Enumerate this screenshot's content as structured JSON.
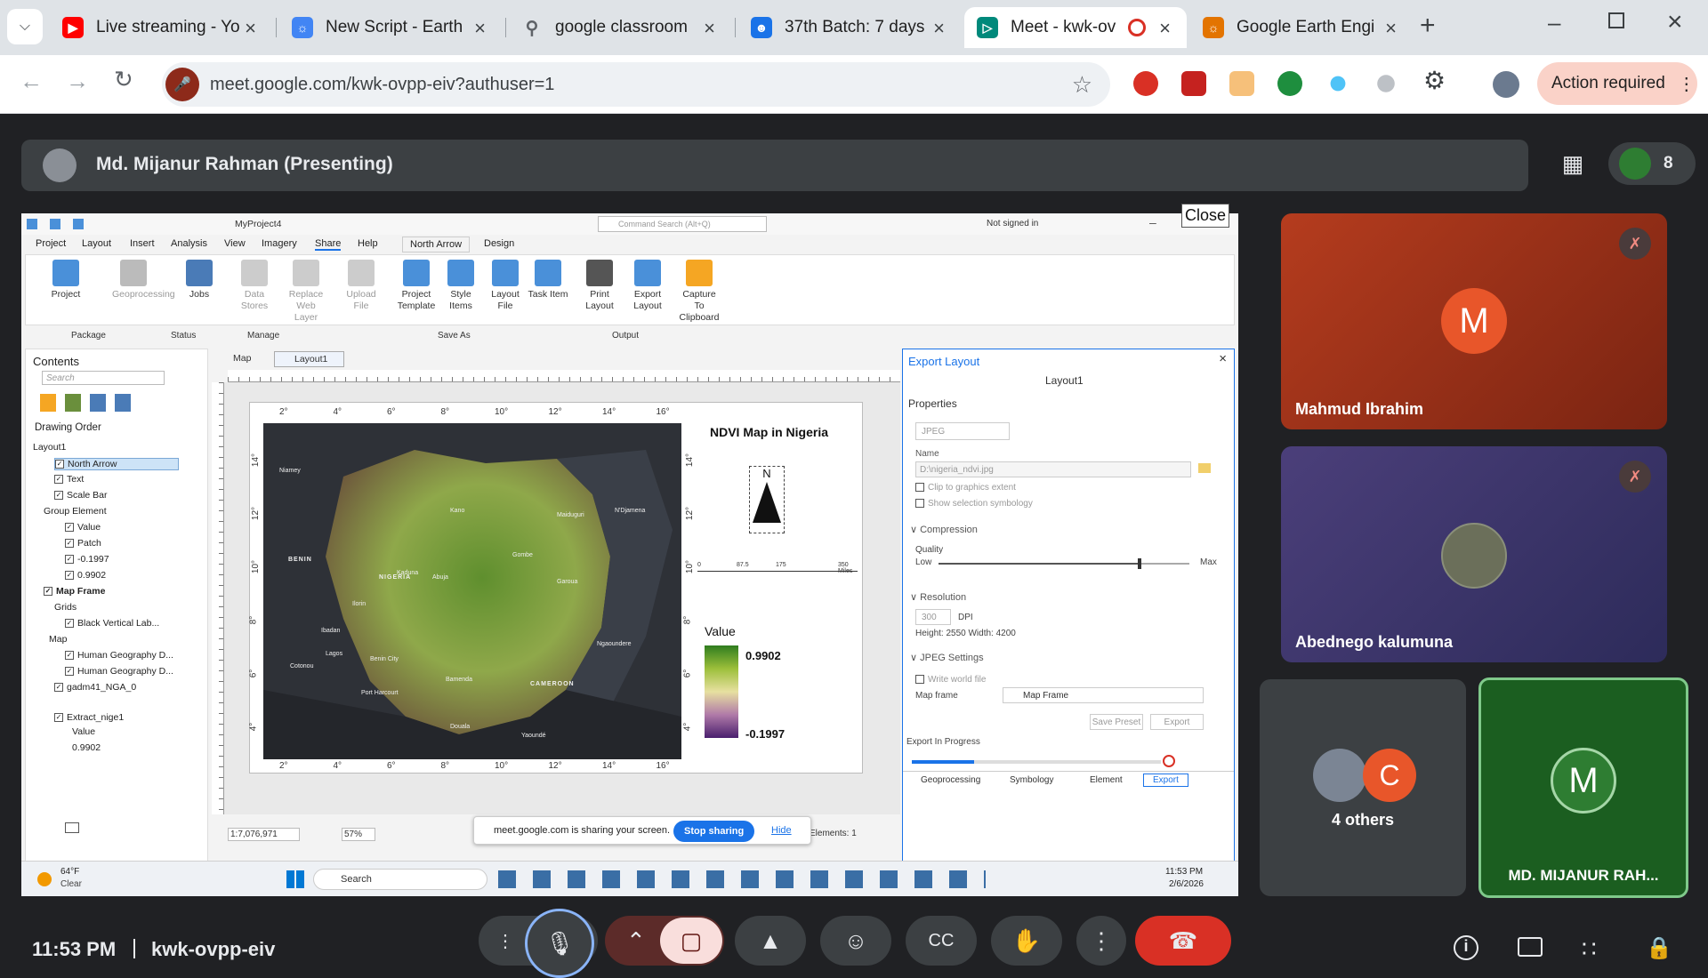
{
  "browser": {
    "tabs": [
      {
        "title": "Live streaming - Yo",
        "icon": "youtube-icon",
        "color": "#ff0000"
      },
      {
        "title": "New Script - Earth",
        "icon": "earth-engine-icon",
        "color": "#1a73e8"
      },
      {
        "title": "google classroom",
        "icon": "search-icon",
        "color": "#5f6368"
      },
      {
        "title": "37th Batch: 7 days",
        "icon": "classroom-icon",
        "color": "#1a73e8"
      },
      {
        "title": "Meet - kwk-ov",
        "icon": "meet-icon",
        "color": "#00897b"
      },
      {
        "title": "Google Earth Engi",
        "icon": "earth-engine-icon",
        "color": "#e37400"
      }
    ],
    "url": "meet.google.com/kwk-ovpp-eiv?authuser=1",
    "action_required": "Action required"
  },
  "meet": {
    "presenter": "Md. Mijanur Rahman (Presenting)",
    "participant_count": "8",
    "close_tooltip": "Close",
    "time": "11:53 PM",
    "meeting_code": "kwk-ovpp-eiv",
    "participants": [
      {
        "name": "Mahmud Ibrahim",
        "initial": "M",
        "color": "#e8562a"
      },
      {
        "name": "Abednego kalumuna",
        "initial": "",
        "color": "#5d4a8a"
      },
      {
        "name": "4 others",
        "initial": "C",
        "color": "#e8562a"
      },
      {
        "name": "MD. MIJANUR RAH...",
        "initial": "M",
        "color": "#1e6b2e"
      }
    ],
    "sharing_bar": {
      "text": "meet.google.com is sharing your screen.",
      "stop": "Stop sharing",
      "hide": "Hide"
    }
  },
  "arcgis": {
    "project": "MyProject4",
    "command_search": "Command Search (Alt+Q)",
    "not_signed_in": "Not signed in",
    "menu": [
      "Project",
      "Layout",
      "Insert",
      "Analysis",
      "View",
      "Imagery",
      "Share",
      "Help",
      "North Arrow",
      "Design"
    ],
    "ribbon": [
      {
        "label": "Project",
        "group": "Package"
      },
      {
        "label": "Geoprocessing",
        "group": "Package"
      },
      {
        "label": "Jobs",
        "group": "Status"
      },
      {
        "label": "Data Stores",
        "group": "Manage"
      },
      {
        "label": "Replace Web Layer",
        "group": "Manage"
      },
      {
        "label": "Upload File",
        "group": "Manage"
      },
      {
        "label": "Project Template",
        "group": "Save As"
      },
      {
        "label": "Style Items",
        "group": "Save As"
      },
      {
        "label": "Layout File",
        "group": "Save As"
      },
      {
        "label": "Task Item",
        "group": "Save As"
      },
      {
        "label": "Print Layout",
        "group": "Output"
      },
      {
        "label": "Export Layout",
        "group": "Output"
      },
      {
        "label": "Capture To Clipboard",
        "group": "Output"
      }
    ],
    "groups": [
      "Package",
      "Status",
      "Manage",
      "Save As",
      "Output"
    ],
    "contents": {
      "title": "Contents",
      "search": "Search",
      "drawing_order": "Drawing Order",
      "items": [
        "Layout1",
        "North Arrow",
        "Text",
        "Scale Bar",
        "Group Element",
        "Value",
        "Patch",
        "-0.1997",
        "0.9902",
        "Map Frame",
        "Grids",
        "Black Vertical Lab...",
        "Map",
        "Human Geography D...",
        "Human Geography D...",
        "gadm41_NGA_0",
        "Extract_nige1",
        "Value",
        "0.9902"
      ]
    },
    "view_tabs": [
      "Map",
      "Layout1"
    ],
    "map": {
      "title": "NDVI Map in Nigeria",
      "legend_title": "Value",
      "legend_max": "0.9902",
      "legend_min": "-0.1997",
      "lon_labels": [
        "2°",
        "4°",
        "6°",
        "8°",
        "10°",
        "12°",
        "14°",
        "16°"
      ],
      "lat_labels": [
        "14°",
        "12°",
        "10°",
        "8°",
        "6°",
        "4°"
      ],
      "scale_labels": [
        "0",
        "87.5",
        "175",
        "350 Miles"
      ],
      "places": [
        "BENIN",
        "NIGERIA",
        "CAMEROON",
        "Kano",
        "Maiduguri",
        "N'Djamena",
        "Kaduna",
        "Gombe",
        "Abuja",
        "Garoua",
        "Ilorin",
        "Ibadan",
        "Lagos",
        "Benin City",
        "Port Harcourt",
        "Bamenda",
        "Douala",
        "Yaoundé",
        "Niamey",
        "Cotonou",
        "Ngaoundere"
      ],
      "north": "N"
    },
    "status": {
      "scale": "1:7,076,971",
      "zoom": "57%",
      "elements": "Elements: 1"
    },
    "export": {
      "title": "Export Layout",
      "layout": "Layout1",
      "properties": "Properties",
      "format": "JPEG",
      "name_label": "Name",
      "name_value": "D:\\nigeria_ndvi.jpg",
      "clip": "Clip to graphics extent",
      "show_sel": "Show selection symbology",
      "compression": "Compression",
      "quality": "Quality",
      "low": "Low",
      "max": "Max",
      "quality_value": 0.8,
      "resolution": "Resolution",
      "dpi": "300",
      "dpi_label": "DPI",
      "size": "Height: 2550  Width: 4200",
      "jpeg_settings": "JPEG Settings",
      "world_file": "Write world file",
      "map_frame_label": "Map frame",
      "map_frame": "Map Frame",
      "save_preset": "Save Preset",
      "export_btn": "Export",
      "progress_label": "Export In Progress",
      "progress": 0.25,
      "bottom_tabs": [
        "Geoprocessing",
        "Symbology",
        "Element",
        "Export"
      ]
    },
    "taskbar": {
      "weather_temp": "64°F",
      "weather": "Clear",
      "search": "Search",
      "time": "11:53 PM",
      "date": "2/6/2026"
    }
  }
}
